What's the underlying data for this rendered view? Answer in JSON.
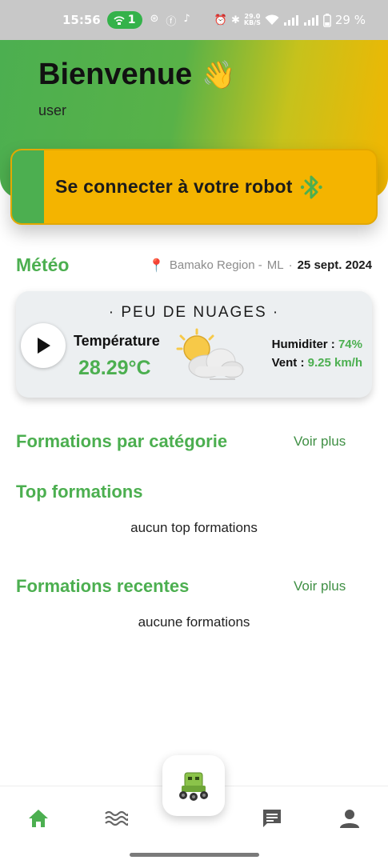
{
  "status_bar": {
    "time": "15:56",
    "hotspot_count": "1",
    "net_speed_top": "29.0",
    "net_speed_unit": "KB/S",
    "battery": "29 %"
  },
  "header": {
    "title": "Bienvenue",
    "wave_emoji": "👋",
    "username": "user"
  },
  "connect": {
    "label": "Se connecter à votre robot",
    "icon": "bluetooth-icon"
  },
  "meteo": {
    "title": "Météo",
    "region": "Bamako Region -",
    "country": "ML",
    "separator": "·",
    "date": "25 sept. 2024",
    "description": "· PEU DE NUAGES ·",
    "temperature_label": "Température",
    "temperature_value": "28.29°C",
    "humidity_label": "Humiditer :",
    "humidity_value": "74%",
    "wind_label": "Vent :",
    "wind_value": "9.25 km/h"
  },
  "sections": {
    "categories": {
      "title": "Formations par catégorie",
      "more": "Voir plus"
    },
    "top": {
      "title": "Top formations",
      "empty": "aucun top formations"
    },
    "recent": {
      "title": "Formations recentes",
      "more": "Voir plus",
      "empty": "aucune formations"
    }
  },
  "colors": {
    "primary_green": "#4caf50",
    "accent_yellow": "#f4b400"
  },
  "bottom_nav": {
    "items": [
      "home-icon",
      "waves-icon",
      "robot-icon",
      "chat-icon",
      "profile-icon"
    ],
    "active": "home-icon"
  }
}
